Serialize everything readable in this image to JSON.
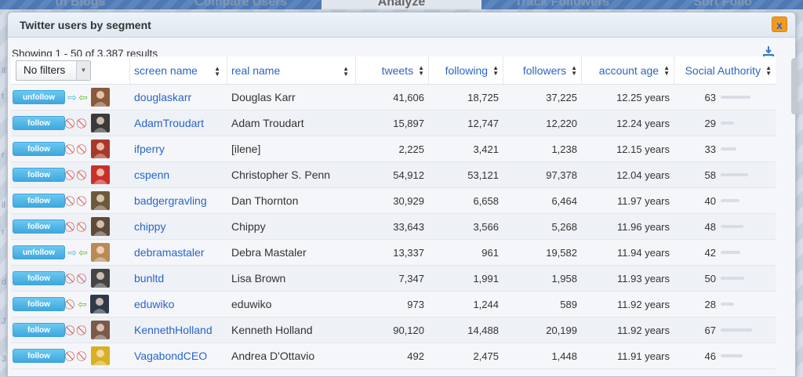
{
  "nav": [
    "th Blogs",
    "Compare Users",
    "Analyze",
    "Track Followers",
    "Sort Follo"
  ],
  "bg_letters": [
    "it",
    "t",
    "r",
    "il",
    "r",
    "d",
    "J",
    "3"
  ],
  "dialog": {
    "title": "Twitter users by segment",
    "close_label": "x",
    "results": "Showing 1 - 50 of 3,387 results",
    "filter_label": "No filters"
  },
  "columns": {
    "screen_name": "screen name",
    "real_name": "real name",
    "tweets": "tweets",
    "following": "following",
    "followers": "followers",
    "account_age": "account age",
    "social_authority": "Social Authority"
  },
  "colors": {
    "accent": "#2b64c8",
    "button": "#3ea8de",
    "block": "#d23a3a",
    "close": "#f39a1e"
  },
  "rows": [
    {
      "action": "unfollow",
      "mutual": true,
      "screen": "douglaskarr",
      "real": "Douglas Karr",
      "tweets": "41,606",
      "following": "18,725",
      "followers": "37,225",
      "age": "12.25 years",
      "sa": "63",
      "sa_value": 63,
      "avatar_color": "#8a5a3a"
    },
    {
      "action": "follow",
      "mutual": false,
      "screen": "AdamTroudart",
      "real": "Adam Troudart",
      "tweets": "15,897",
      "following": "12,747",
      "followers": "12,220",
      "age": "12.24 years",
      "sa": "29",
      "sa_value": 29,
      "avatar_color": "#3a3a3a"
    },
    {
      "action": "follow",
      "mutual": false,
      "screen": "ifperry",
      "real": "[ilene]",
      "tweets": "2,225",
      "following": "3,421",
      "followers": "1,238",
      "age": "12.15 years",
      "sa": "33",
      "sa_value": 33,
      "avatar_color": "#a8392a"
    },
    {
      "action": "follow",
      "mutual": false,
      "screen": "cspenn",
      "real": "Christopher S. Penn",
      "tweets": "54,912",
      "following": "53,121",
      "followers": "97,378",
      "age": "12.04 years",
      "sa": "58",
      "sa_value": 58,
      "avatar_color": "#c8302a"
    },
    {
      "action": "follow",
      "mutual": false,
      "screen": "badgergravling",
      "real": "Dan Thornton",
      "tweets": "30,929",
      "following": "6,658",
      "followers": "6,464",
      "age": "11.97 years",
      "sa": "40",
      "sa_value": 40,
      "avatar_color": "#6d5a3c"
    },
    {
      "action": "follow",
      "mutual": false,
      "screen": "chippy",
      "real": "Chippy",
      "tweets": "33,643",
      "following": "3,566",
      "followers": "5,268",
      "age": "11.96 years",
      "sa": "48",
      "sa_value": 48,
      "avatar_color": "#5f4a3a"
    },
    {
      "action": "unfollow",
      "mutual": true,
      "screen": "debramastaler",
      "real": "Debra Mastaler",
      "tweets": "13,337",
      "following": "961",
      "followers": "19,582",
      "age": "11.94 years",
      "sa": "42",
      "sa_value": 42,
      "avatar_color": "#b88a55"
    },
    {
      "action": "follow",
      "mutual": false,
      "screen": "bunltd",
      "real": "Lisa Brown",
      "tweets": "7,347",
      "following": "1,991",
      "followers": "1,958",
      "age": "11.93 years",
      "sa": "50",
      "sa_value": 50,
      "avatar_color": "#444444"
    },
    {
      "action": "follow",
      "mutual": false,
      "follows_you": true,
      "screen": "eduwiko",
      "real": "eduwiko",
      "tweets": "973",
      "following": "1,244",
      "followers": "589",
      "age": "11.92 years",
      "sa": "28",
      "sa_value": 28,
      "avatar_color": "#2e3a4a"
    },
    {
      "action": "follow",
      "mutual": false,
      "screen": "KennethHolland",
      "real": "Kenneth Holland",
      "tweets": "90,120",
      "following": "14,488",
      "followers": "20,199",
      "age": "11.92 years",
      "sa": "67",
      "sa_value": 67,
      "avatar_color": "#7a5a4a"
    },
    {
      "action": "follow",
      "mutual": false,
      "screen": "VagabondCEO",
      "real": "Andrea D'Ottavio",
      "tweets": "492",
      "following": "2,475",
      "followers": "1,448",
      "age": "11.91 years",
      "sa": "46",
      "sa_value": 46,
      "avatar_color": "#d8b020"
    }
  ]
}
